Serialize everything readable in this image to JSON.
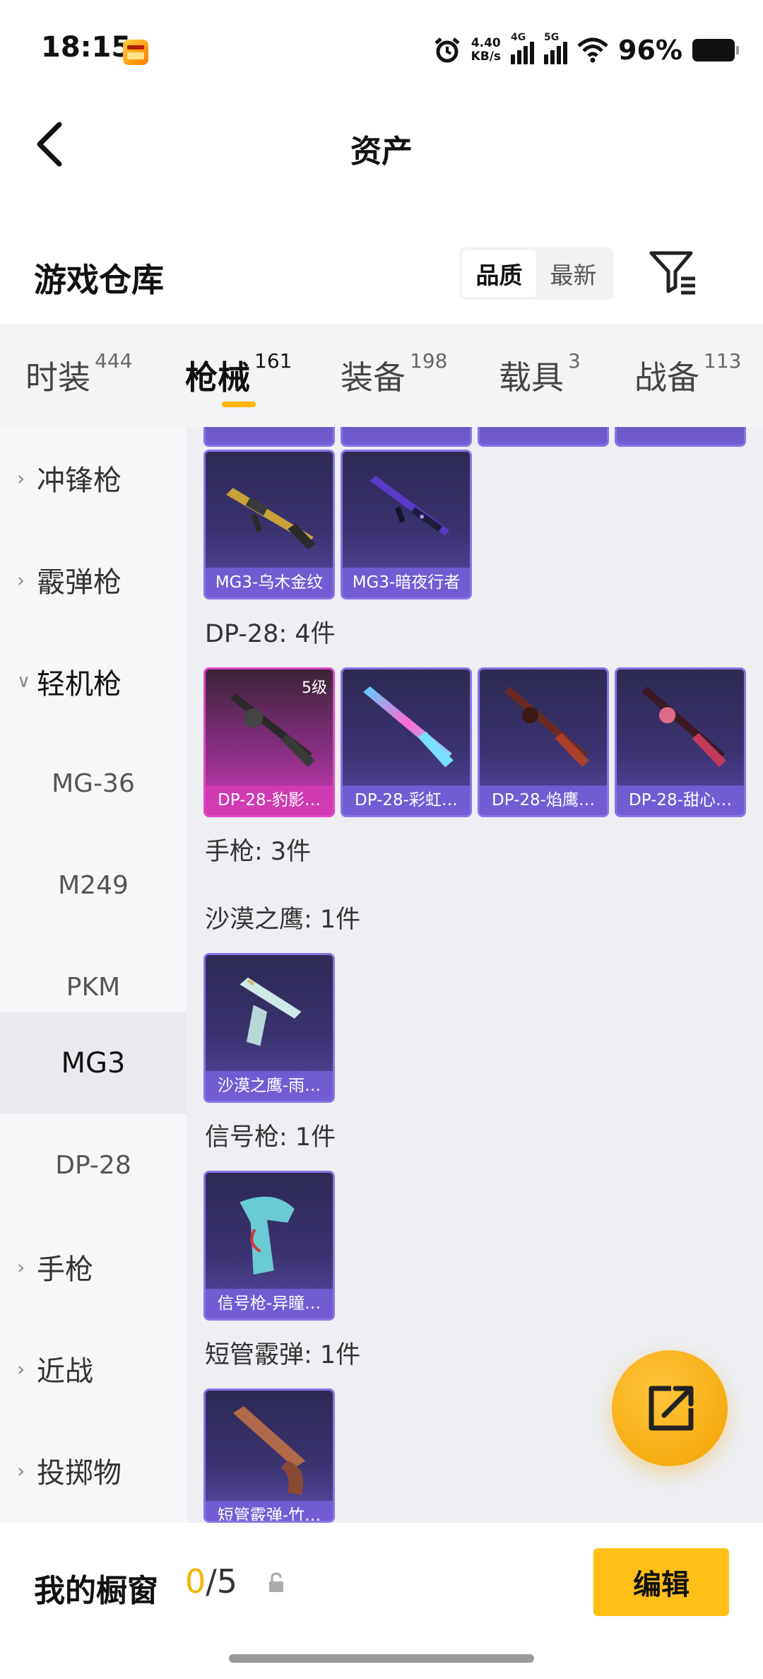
{
  "status_bar": {
    "time": "18:15",
    "speed_value": "4.40",
    "speed_unit": "KB/s",
    "signal1": "4G",
    "signal2": "5G",
    "battery": "96%",
    "icons": [
      "alarm-icon",
      "signal-icon",
      "wifi-icon",
      "battery-icon"
    ]
  },
  "header": {
    "title": "资产"
  },
  "warehouse": {
    "title": "游戏仓库",
    "sort_options": [
      "品质",
      "最新"
    ],
    "sort_selected": "品质"
  },
  "tabs": [
    {
      "label": "时装",
      "count": "444"
    },
    {
      "label": "枪械",
      "count": "161"
    },
    {
      "label": "装备",
      "count": "198"
    },
    {
      "label": "载具",
      "count": "3"
    },
    {
      "label": "战备",
      "count": "113"
    }
  ],
  "sidebar": {
    "items": [
      {
        "label": "冲锋枪",
        "type": "group"
      },
      {
        "label": "霰弹枪",
        "type": "group"
      },
      {
        "label": "轻机枪",
        "type": "group-open"
      },
      {
        "label": "MG-36",
        "type": "sub"
      },
      {
        "label": "M249",
        "type": "sub"
      },
      {
        "label": "PKM",
        "type": "sub"
      },
      {
        "label": "MG3",
        "type": "sub-active"
      },
      {
        "label": "DP-28",
        "type": "sub"
      },
      {
        "label": "手枪",
        "type": "group"
      },
      {
        "label": "近战",
        "type": "group"
      },
      {
        "label": "投掷物",
        "type": "group"
      }
    ]
  },
  "content": {
    "mg3_cards": [
      {
        "name": "MG3-乌木金纹"
      },
      {
        "name": "MG3-暗夜行者"
      }
    ],
    "dp28_label": "DP-28: 4件",
    "dp28_cards": [
      {
        "name": "DP-28-豹影…",
        "level": "5级"
      },
      {
        "name": "DP-28-彩虹…"
      },
      {
        "name": "DP-28-焰鹰…"
      },
      {
        "name": "DP-28-甜心…"
      }
    ],
    "pistol_label": "手枪: 3件",
    "deagle_label": "沙漠之鹰: 1件",
    "deagle_cards": [
      {
        "name": "沙漠之鹰-雨…"
      }
    ],
    "flare_label": "信号枪: 1件",
    "flare_cards": [
      {
        "name": "信号枪-异瞳…"
      }
    ],
    "shortsg_label": "短管霰弹: 1件",
    "shortsg_cards": [
      {
        "name": "短管霰弹-竹…"
      }
    ]
  },
  "bottom": {
    "showcase_label": "我的橱窗",
    "count_current": "0",
    "count_total": "/5",
    "edit_label": "编辑"
  },
  "colors": {
    "accent": "#ffbf17",
    "card_purple": "#3a3270",
    "card_pink": "#d23ab6"
  }
}
